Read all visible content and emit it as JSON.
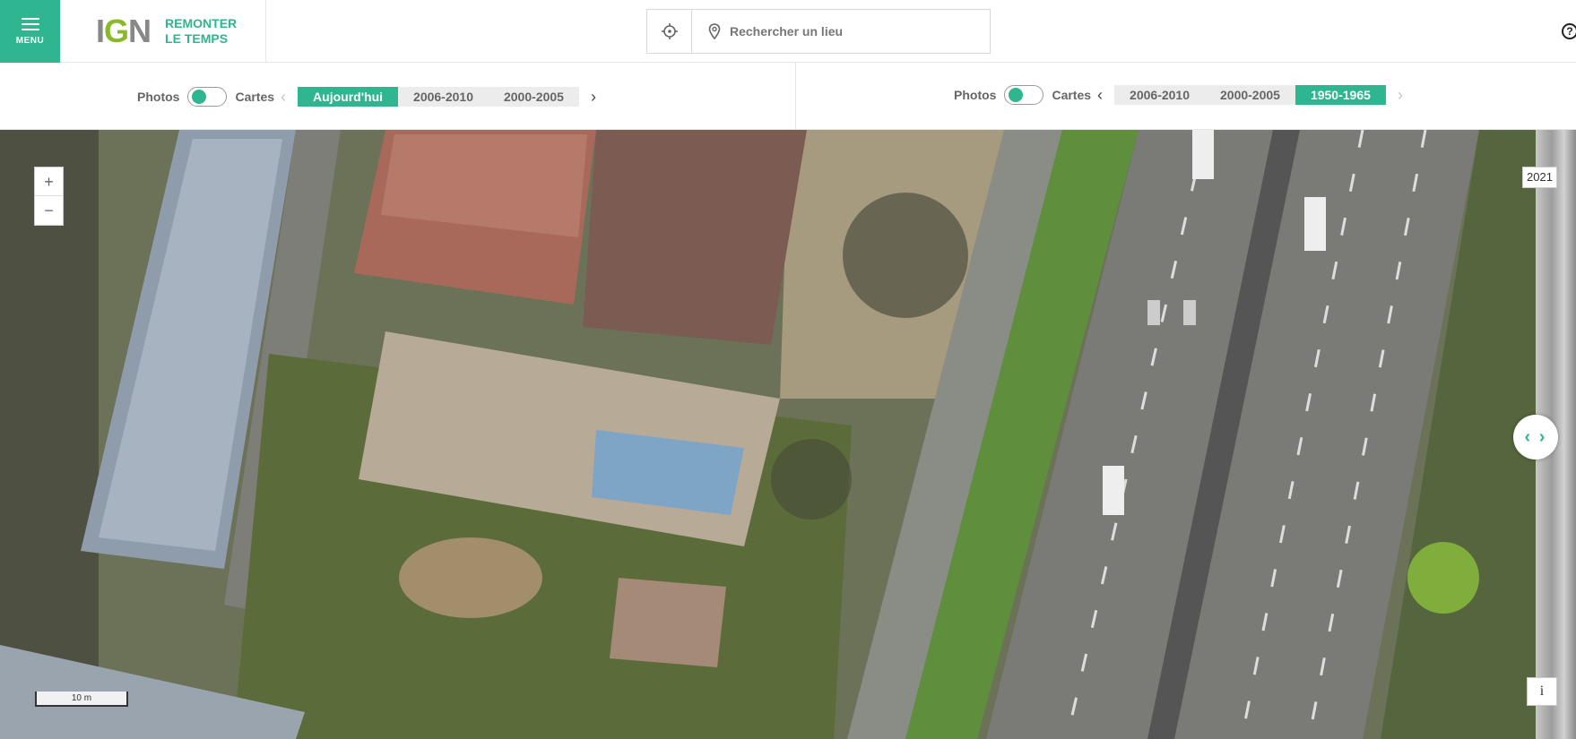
{
  "header": {
    "menu_label": "MENU",
    "brand_title_line1": "REMONTER",
    "brand_title_line2": "LE TEMPS",
    "search_placeholder": "Rechercher un lieu",
    "help_label": "?"
  },
  "left_panel": {
    "photos_label": "Photos",
    "cartes_label": "Cartes",
    "years": [
      "Aujourd'hui",
      "2006-2010",
      "2000-2005"
    ],
    "selected_year": "Aujourd'hui"
  },
  "right_panel": {
    "photos_label": "Photos",
    "cartes_label": "Cartes",
    "years": [
      "2006-2010",
      "2000-2005",
      "1950-1965"
    ],
    "selected_year": "1950-1965"
  },
  "map": {
    "zoom_in_label": "+",
    "zoom_out_label": "−",
    "scale_label": "10 m",
    "year_tag": "2021",
    "info_label": "i",
    "swipe_label": "‹ ›"
  },
  "colors": {
    "accent": "#2fb58f",
    "brand_green": "#8ab82a"
  },
  "icons": [
    "menu-icon",
    "crosshair-icon",
    "location-pin-icon",
    "help-icon",
    "chevron-left-icon",
    "chevron-right-icon",
    "swipe-icon",
    "info-icon"
  ]
}
